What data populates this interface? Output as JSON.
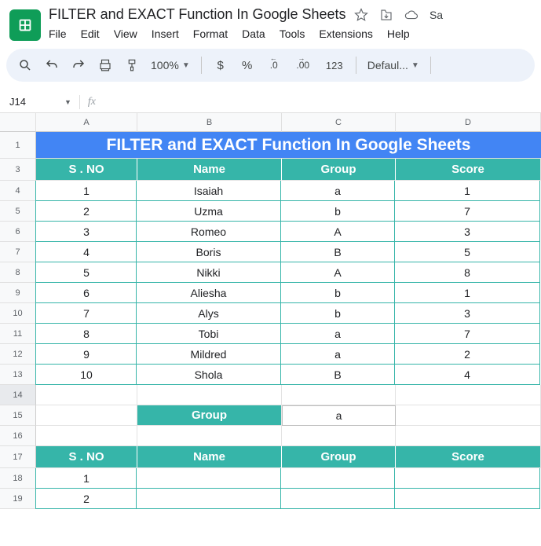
{
  "doc": {
    "title": "FILTER and EXACT Function In Google Sheets",
    "truncated_btn": "Sa"
  },
  "menu": [
    "File",
    "Edit",
    "View",
    "Insert",
    "Format",
    "Data",
    "Tools",
    "Extensions",
    "Help"
  ],
  "toolbar": {
    "zoom": "100%",
    "currency": "$",
    "percent": "%",
    "dec_dec": ".0",
    "inc_dec": ".00",
    "num_fmt": "123",
    "font": "Defaul..."
  },
  "namebox": {
    "ref": "J14",
    "formula": ""
  },
  "cols": [
    "A",
    "B",
    "C",
    "D"
  ],
  "rows_visible": [
    "1",
    "3",
    "4",
    "5",
    "6",
    "7",
    "8",
    "9",
    "10",
    "11",
    "12",
    "13",
    "14",
    "15",
    "16",
    "17",
    "18",
    "19"
  ],
  "sheet": {
    "title": "FILTER and EXACT Function In Google Sheets",
    "headers": [
      "S . NO",
      "Name",
      "Group",
      "Score"
    ],
    "data": [
      [
        "1",
        "Isaiah",
        "a",
        "1"
      ],
      [
        "2",
        "Uzma",
        "b",
        "7"
      ],
      [
        "3",
        "Romeo",
        "A",
        "3"
      ],
      [
        "4",
        "Boris",
        "B",
        "5"
      ],
      [
        "5",
        "Nikki",
        "A",
        "8"
      ],
      [
        "6",
        "Aliesha",
        "b",
        "1"
      ],
      [
        "7",
        "Alys",
        "b",
        "3"
      ],
      [
        "8",
        "Tobi",
        "a",
        "7"
      ],
      [
        "9",
        "Mildred",
        "a",
        "2"
      ],
      [
        "10",
        "Shola",
        "B",
        "4"
      ]
    ],
    "lookup_label": "Group",
    "lookup_value": "a",
    "headers2": [
      "S . NO",
      "Name",
      "Group",
      "Score"
    ],
    "result": [
      [
        "1",
        "",
        "",
        ""
      ],
      [
        "2",
        "",
        "",
        ""
      ]
    ]
  }
}
